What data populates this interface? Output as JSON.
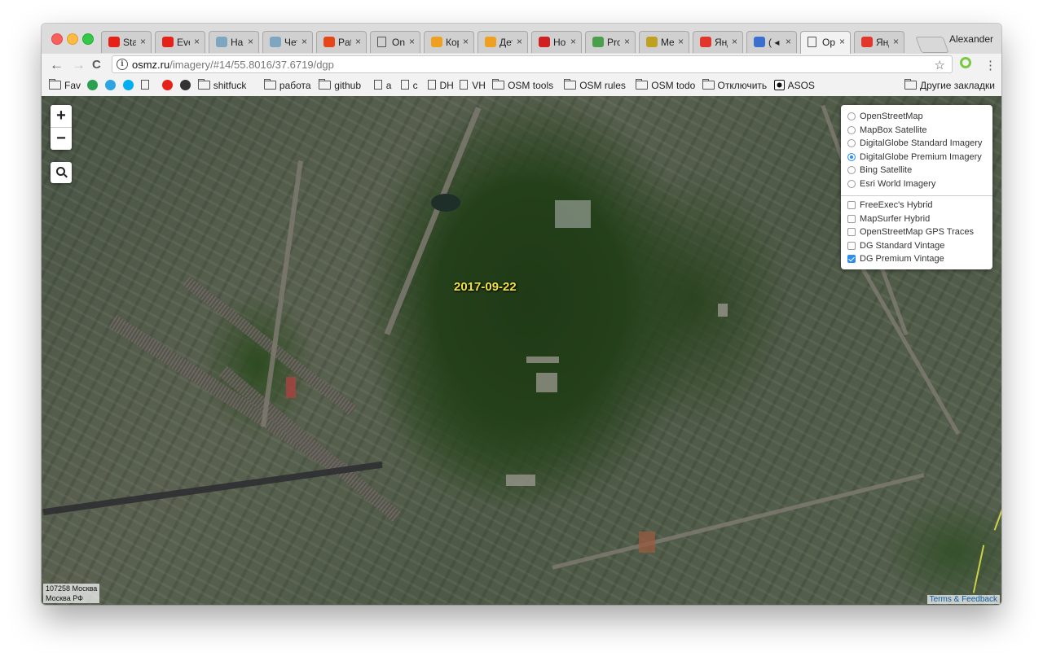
{
  "window": {
    "profile_name": "Alexander",
    "tabs": [
      {
        "title": "Sta",
        "icon": "youtube-icon",
        "color": "#e62117"
      },
      {
        "title": "Eve",
        "icon": "youtube-icon",
        "color": "#e62117"
      },
      {
        "title": "Hal",
        "icon": "habr-icon",
        "color": "#7fa6c1"
      },
      {
        "title": "Чет",
        "icon": "habr-icon",
        "color": "#7fa6c1"
      },
      {
        "title": "Pat",
        "icon": "patreon-icon",
        "color": "#e6461a"
      },
      {
        "title": "On",
        "icon": "page-icon",
        "color": "#777777"
      },
      {
        "title": "Кор",
        "icon": "cat-icon",
        "color": "#f0a020"
      },
      {
        "title": "Дет",
        "icon": "cat-icon",
        "color": "#f0a020"
      },
      {
        "title": "Hor",
        "icon": "tv-icon",
        "color": "#d02020"
      },
      {
        "title": "Pro",
        "icon": "tool-icon",
        "color": "#4aa04a"
      },
      {
        "title": "Me",
        "icon": "train-icon",
        "color": "#c0a020"
      },
      {
        "title": "Янд",
        "icon": "yandex-maps-icon",
        "color": "#e2362c"
      },
      {
        "title": "( ◂",
        "icon": "video-icon",
        "color": "#3a6fd0"
      },
      {
        "title": "Op",
        "icon": "page-icon",
        "color": "#777777",
        "active": true
      },
      {
        "title": "Янд",
        "icon": "yandex-maps-icon",
        "color": "#e2362c"
      }
    ],
    "tab_close_glyph": "×"
  },
  "toolbar": {
    "back": "←",
    "forward": "→",
    "reload": "C",
    "url_host": "osmz.ru",
    "url_path": "/imagery/#14/55.8016/37.6719/dgp",
    "star": "☆",
    "menu": "⋮"
  },
  "bookmarks": [
    {
      "label": "Fav",
      "type": "folder"
    },
    {
      "label": "",
      "type": "icon",
      "icon": "badge-1-icon",
      "color": "#2aa050"
    },
    {
      "label": "",
      "type": "icon",
      "icon": "telegram-icon",
      "color": "#2ca5e0"
    },
    {
      "label": "",
      "type": "icon",
      "icon": "skype-icon",
      "color": "#00aff0"
    },
    {
      "label": "",
      "type": "page"
    },
    {
      "label": "",
      "type": "icon",
      "icon": "youtube-icon",
      "color": "#e62117"
    },
    {
      "label": "",
      "type": "icon",
      "icon": "apple-icon",
      "color": "#333333"
    },
    {
      "label": "shitfuck",
      "type": "folder"
    },
    {
      "label": "работа",
      "type": "folder"
    },
    {
      "label": "github",
      "type": "folder"
    },
    {
      "label": "a",
      "type": "page"
    },
    {
      "label": "c",
      "type": "page"
    },
    {
      "label": "DH",
      "type": "page"
    },
    {
      "label": "VH",
      "type": "page"
    },
    {
      "label": "OSM tools",
      "type": "folder"
    },
    {
      "label": "OSM rules",
      "type": "folder"
    },
    {
      "label": "OSM todo",
      "type": "folder"
    },
    {
      "label": "Отключить",
      "type": "folder"
    },
    {
      "label": "ASOS",
      "type": "asos"
    }
  ],
  "other_bookmarks": "Другие закладки",
  "map": {
    "zoom_in": "+",
    "zoom_out": "−",
    "imagery_date": "2017-09-22",
    "base_layers": [
      {
        "label": "OpenStreetMap",
        "selected": false
      },
      {
        "label": "MapBox Satellite",
        "selected": false
      },
      {
        "label": "DigitalGlobe Standard Imagery",
        "selected": false
      },
      {
        "label": "DigitalGlobe Premium Imagery",
        "selected": true
      },
      {
        "label": "Bing Satellite",
        "selected": false
      },
      {
        "label": "Esri World Imagery",
        "selected": false
      }
    ],
    "overlays": [
      {
        "label": "FreeExec's Hybrid",
        "checked": false
      },
      {
        "label": "MapSurfer Hybrid",
        "checked": false
      },
      {
        "label": "OpenStreetMap GPS Traces",
        "checked": false
      },
      {
        "label": "DG Standard Vintage",
        "checked": false
      },
      {
        "label": "DG Premium Vintage",
        "checked": true
      }
    ],
    "address_line1": "107258 Москва",
    "address_line2": "Москва РФ",
    "terms": "Terms & Feedback"
  }
}
